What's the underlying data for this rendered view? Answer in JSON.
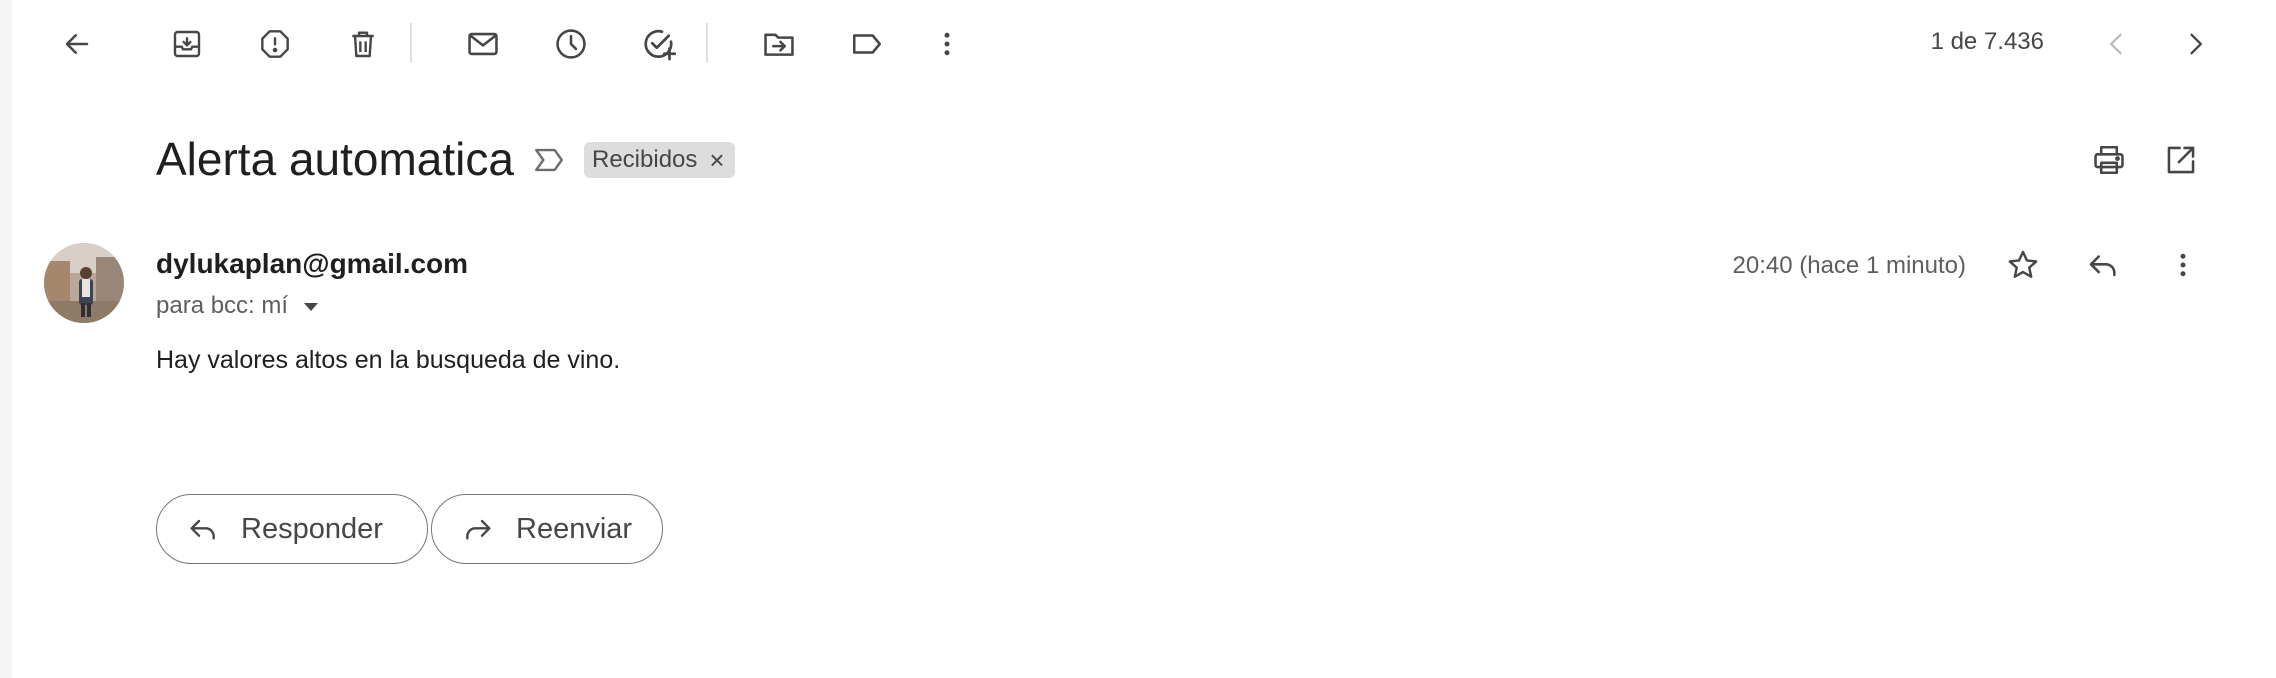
{
  "toolbar": {
    "back_icon": "arrow-left-icon",
    "archive_icon": "archive-icon",
    "report_spam_icon": "report-spam-icon",
    "delete_icon": "trash-icon",
    "mark_unread_icon": "envelope-icon",
    "snooze_icon": "clock-icon",
    "add_task_icon": "add-task-icon",
    "move_to_icon": "move-to-folder-icon",
    "labels_icon": "label-icon",
    "more_icon": "more-vertical-icon",
    "pager_text": "1 de 7.436",
    "newer_icon": "chevron-left-icon",
    "older_icon": "chevron-right-icon"
  },
  "header": {
    "subject": "Alerta automatica",
    "importance_icon": "importance-marker-icon",
    "label_chip": "Recibidos",
    "label_remove": "×",
    "print_icon": "printer-icon",
    "new_window_icon": "open-in-new-window-icon"
  },
  "message": {
    "sender": "dylukaplan@gmail.com",
    "recipients": "para bcc: mí",
    "timestamp": "20:40 (hace 1 minuto)",
    "body": "Hay valores altos en la busqueda de vino.",
    "star_icon": "star-icon",
    "reply_icon": "reply-icon",
    "more_icon": "more-vertical-icon"
  },
  "actions": {
    "reply_label": "Responder",
    "forward_label": "Reenviar"
  },
  "colors": {
    "icon": "#444746",
    "disabled_icon": "#bdbdbd",
    "chip_bg": "#dddddd",
    "panel_bg": "#ffffff",
    "page_bg": "#f5f5f5"
  }
}
